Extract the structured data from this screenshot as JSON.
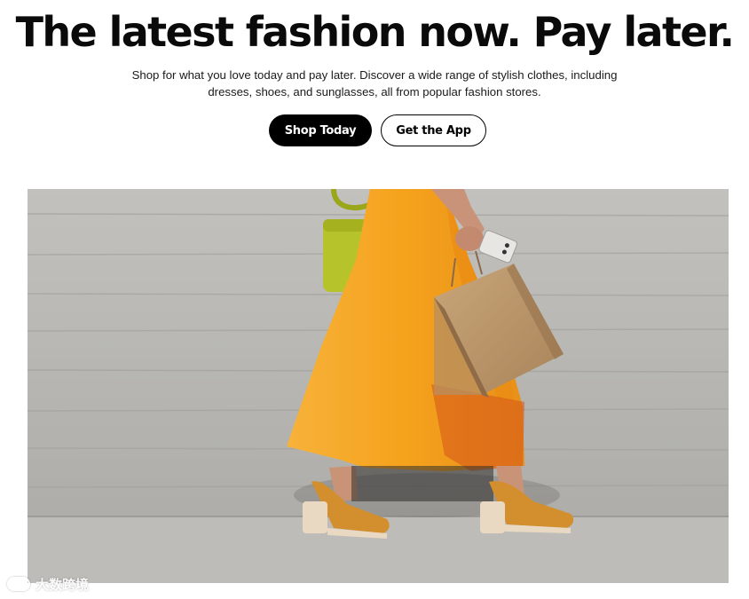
{
  "hero": {
    "headline": "The latest fashion now. Pay later.",
    "description": "Shop for what you love today and pay later. Discover a wide range of stylish clothes, including dresses, shoes, and sunglasses, all from popular fashion stores.",
    "primary_cta": "Shop Today",
    "secondary_cta": "Get the App"
  },
  "image": {
    "subject": "woman-in-orange-skirt-with-shopping-bags"
  },
  "watermark": {
    "text": "大数跨境"
  },
  "colors": {
    "primary_button_bg": "#000000",
    "primary_button_text": "#ffffff",
    "secondary_button_border": "#000000",
    "skirt": "#f5a623",
    "wall": "#b9b8b4"
  }
}
